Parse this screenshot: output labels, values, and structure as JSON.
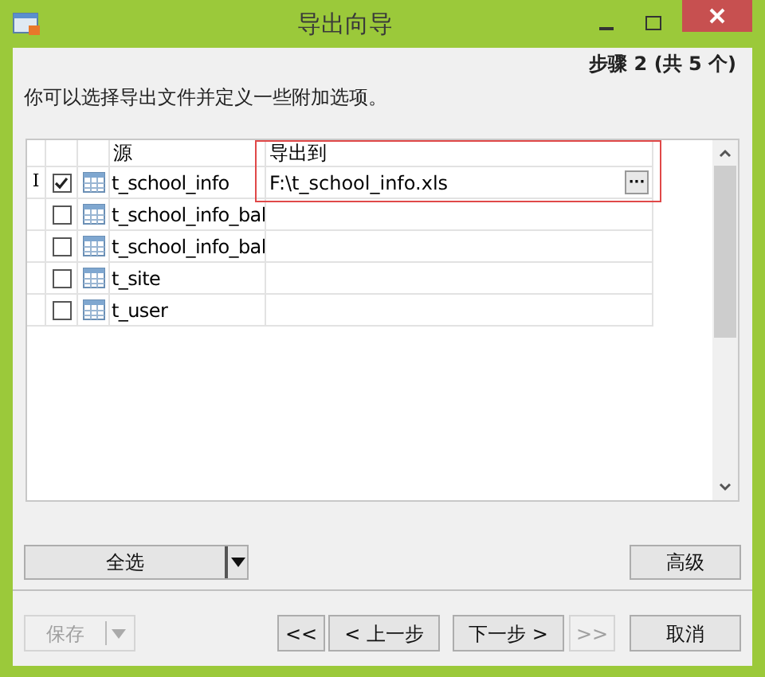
{
  "window": {
    "title": "导出向导"
  },
  "step": "步骤 2 (共 5 个)",
  "description": "你可以选择导出文件并定义一些附加选项。",
  "table": {
    "columns": [
      "源",
      "导出到"
    ],
    "rows": [
      {
        "marker": "I",
        "checked": true,
        "source": "t_school_info",
        "target": "F:\\t_school_info.xls",
        "browse": "···"
      },
      {
        "checked": false,
        "source": "t_school_info_bal"
      },
      {
        "checked": false,
        "source": "t_school_info_bal"
      },
      {
        "checked": false,
        "source": "t_site"
      },
      {
        "checked": false,
        "source": "t_user"
      }
    ]
  },
  "select_all": {
    "label": "全选"
  },
  "advanced": {
    "label": "高级"
  },
  "footer": [
    {
      "kind": "split",
      "label": "保存",
      "disabled": true
    },
    {
      "kind": "button",
      "label": "<<",
      "disabled": false
    },
    {
      "kind": "button",
      "label": "< 上一步",
      "disabled": false
    },
    {
      "kind": "button",
      "label": "下一步 >",
      "disabled": false
    },
    {
      "kind": "button",
      "label": ">>",
      "disabled": true
    },
    {
      "kind": "button",
      "label": "取消",
      "disabled": false
    }
  ]
}
